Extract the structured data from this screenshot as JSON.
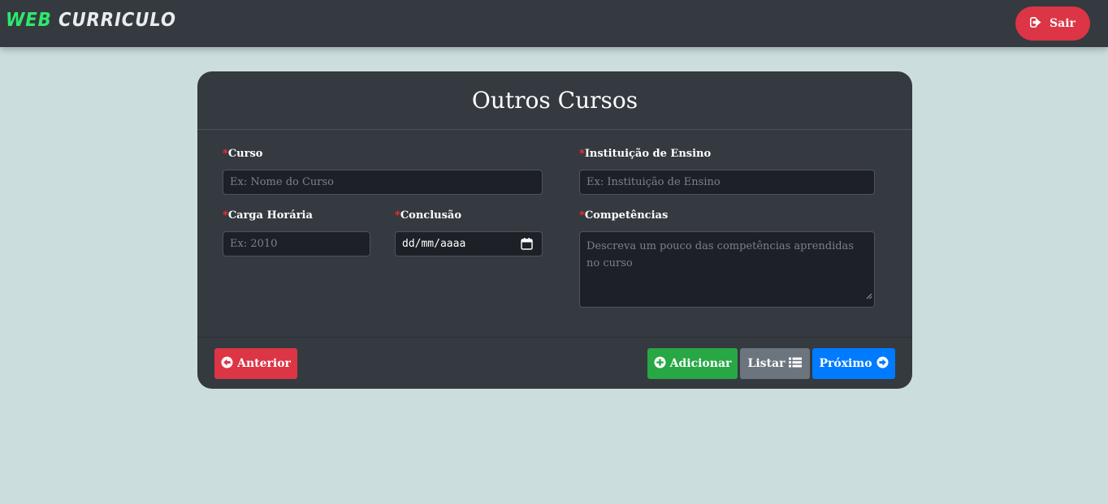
{
  "header": {
    "brand_part1": "WEB",
    "brand_part2": "CURRICULO",
    "logout_label": "Sair",
    "logout_icon": "sign-out-icon"
  },
  "form": {
    "title": "Outros Cursos",
    "required_marker": "*",
    "curso": {
      "label": "Curso",
      "placeholder": "Ex: Nome do Curso",
      "value": ""
    },
    "instituicao": {
      "label": "Instituição de Ensino",
      "placeholder": "Ex: Instituição de Ensino",
      "value": ""
    },
    "carga": {
      "label": "Carga Horária",
      "placeholder": "Ex: 2010",
      "value": ""
    },
    "conclusao": {
      "label": "Conclusão",
      "value": "dd/mm/aaaa",
      "icon": "calendar-icon"
    },
    "competencias": {
      "label": "Competências",
      "placeholder": "Descreva um pouco das competências aprendidas no curso",
      "value": ""
    }
  },
  "footer": {
    "anterior_label": "Anterior",
    "adicionar_label": "Adicionar",
    "listar_label": "Listar",
    "proximo_label": "Próximo"
  },
  "colors": {
    "brand_accent": "#2ee86d",
    "danger": "#dc3545",
    "success": "#28a745",
    "secondary": "#6c757d",
    "primary": "#007bff",
    "card_bg": "#343a40",
    "page_bg": "#cbdedd"
  }
}
